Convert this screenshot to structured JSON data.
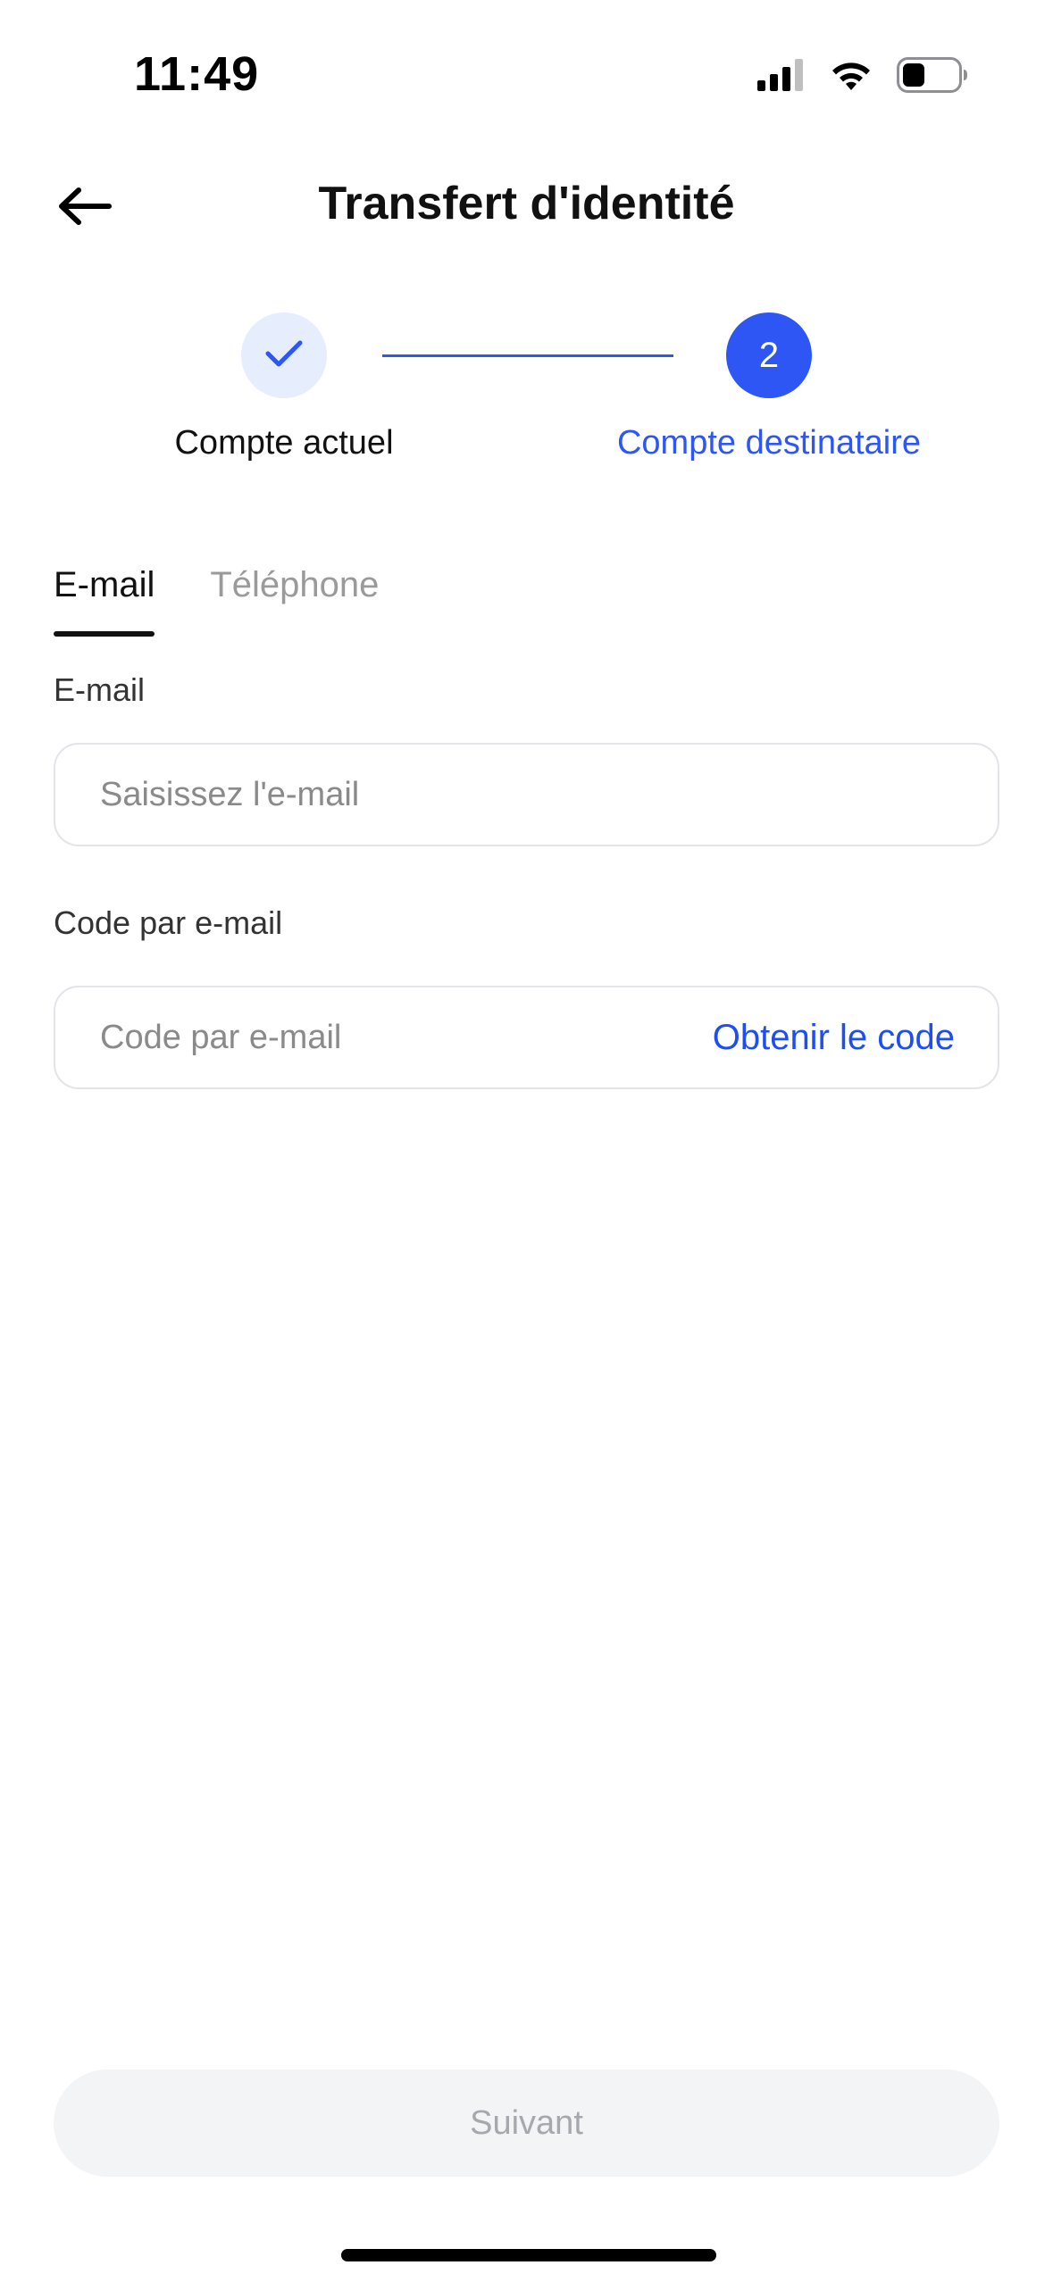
{
  "status_bar": {
    "time": "11:49",
    "icons": [
      "cellular-signal-icon",
      "wifi-icon",
      "battery-icon"
    ]
  },
  "header": {
    "title": "Transfert d'identité",
    "back_icon": "arrow-left-icon"
  },
  "stepper": {
    "steps": [
      {
        "label": "Compte actuel",
        "state": "completed",
        "icon": "checkmark-icon"
      },
      {
        "label": "Compte destinataire",
        "state": "active",
        "number": "2"
      }
    ]
  },
  "tabs": [
    {
      "label": "E-mail",
      "active": true
    },
    {
      "label": "Téléphone",
      "active": false
    }
  ],
  "form": {
    "email": {
      "label": "E-mail",
      "placeholder": "Saisissez l'e-mail",
      "value": ""
    },
    "code": {
      "label": "Code par e-mail",
      "placeholder": "Code par e-mail",
      "value": "",
      "action_label": "Obtenir le code"
    }
  },
  "footer": {
    "next_label": "Suivant",
    "next_enabled": false
  },
  "colors": {
    "accent": "#2d56f5",
    "link": "#1f4ef0",
    "step_done_bg": "#e6edfc",
    "disabled_button_bg": "#f3f4f6",
    "disabled_button_text": "#a6a8ad"
  }
}
